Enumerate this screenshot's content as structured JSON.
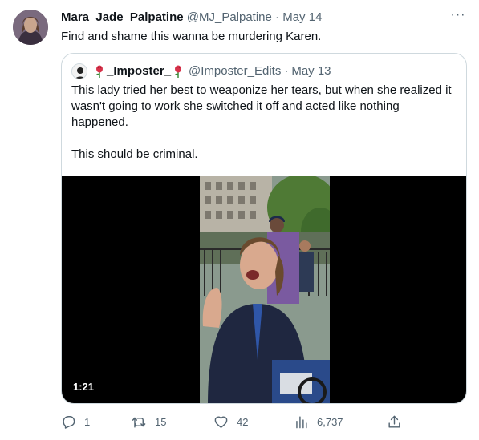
{
  "tweet": {
    "author_name": "Mara_Jade_Palpatine",
    "handle": "@MJ_Palpatine",
    "separator": "·",
    "date": "May 14",
    "text": "Find and shame this wanna be murdering Karen."
  },
  "quoted": {
    "author_name": "_Imposter_",
    "handle": "@Imposter_Edits",
    "separator": "·",
    "date": "May 13",
    "text_lines": [
      "This lady tried her best to weaponize her tears, but when she realized it wasn't going to work she switched it off and acted like nothing happened.",
      "This should be criminal."
    ],
    "video_duration": "1:21"
  },
  "actions": {
    "replies": "1",
    "retweets": "15",
    "likes": "42",
    "views": "6,737"
  },
  "colors": {
    "text": "#0f1419",
    "secondary": "#536471",
    "border": "#cfd9de"
  }
}
